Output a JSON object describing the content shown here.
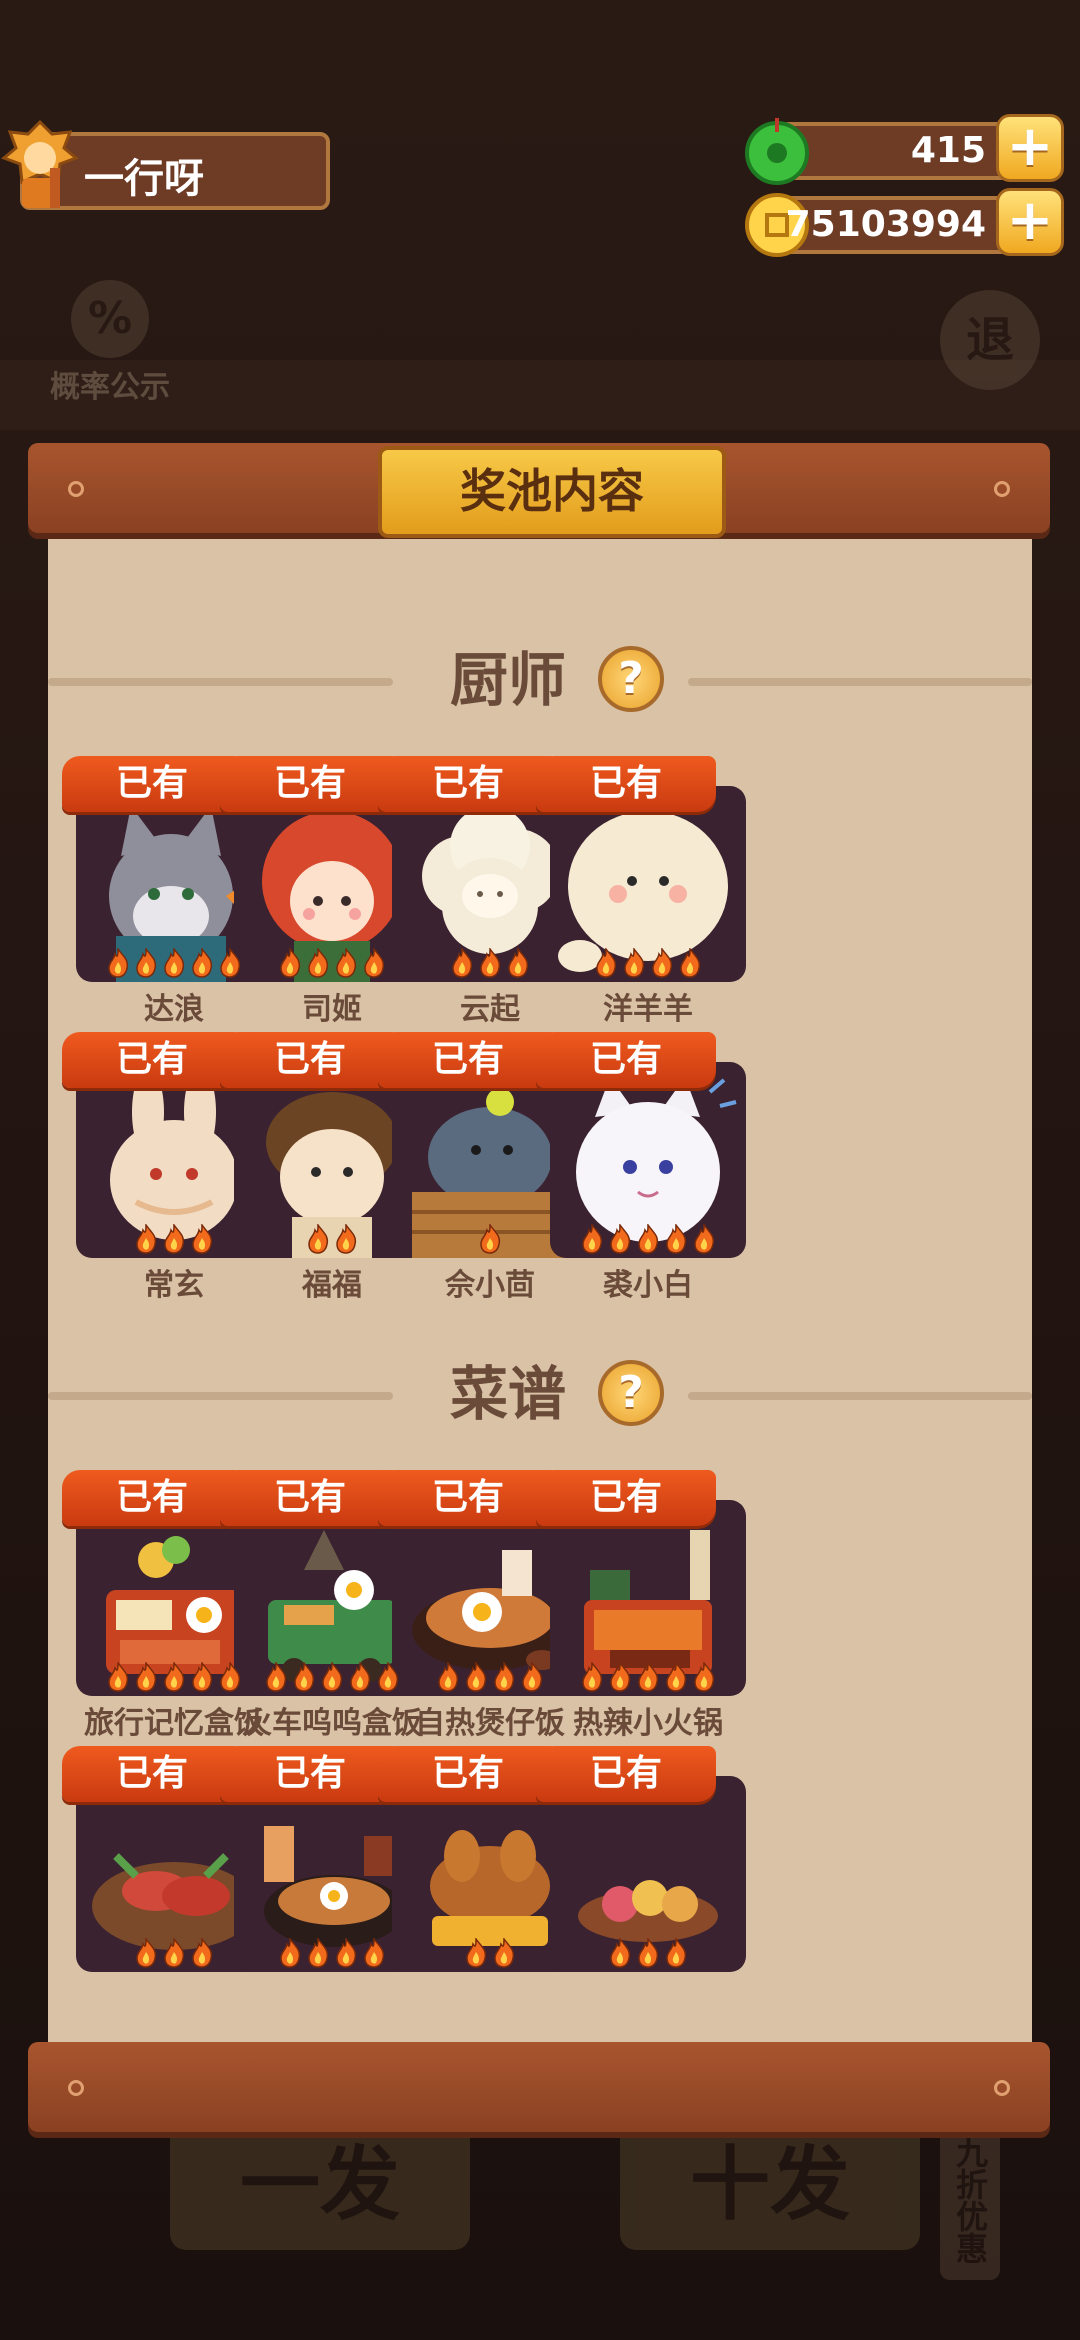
{
  "player": {
    "name": "一行呀"
  },
  "currencies": {
    "jade": "415",
    "coins": "75103994",
    "add_label": "+"
  },
  "background": {
    "probability_label": "概率公示",
    "probability_symbol": "%",
    "exit_label": "退",
    "single_draw_label": "一发",
    "ten_draw_label": "十发",
    "discount_label": "九折优惠"
  },
  "panel": {
    "title": "奖池内容"
  },
  "sections": {
    "chefs": {
      "title": "厨师",
      "help": "?"
    },
    "recipes": {
      "title": "菜谱",
      "help": "?"
    }
  },
  "owned_label": "已有",
  "chefs": [
    {
      "name": "达浪",
      "stars": 5,
      "art": "wolf-chef-art"
    },
    {
      "name": "司姬",
      "stars": 4,
      "art": "red-hair-girl-art"
    },
    {
      "name": "云起",
      "stars": 3,
      "art": "cloud-sheep-art"
    },
    {
      "name": "洋羊羊",
      "stars": 4,
      "art": "white-sheep-art"
    },
    {
      "name": "常玄",
      "stars": 3,
      "art": "rabbit-art"
    },
    {
      "name": "福福",
      "stars": 2,
      "art": "brown-hair-kid-art"
    },
    {
      "name": "佘小茴",
      "stars": 1,
      "art": "seal-in-basket-art"
    },
    {
      "name": "裘小白",
      "stars": 5,
      "art": "white-cat-art"
    }
  ],
  "recipes": [
    {
      "name": "旅行记忆盒饭",
      "stars": 5,
      "art": "bento-box-art"
    },
    {
      "name": "火车呜呜盒饭",
      "stars": 5,
      "art": "train-bento-art"
    },
    {
      "name": "自热煲仔饭",
      "stars": 4,
      "art": "claypot-rice-art"
    },
    {
      "name": "热辣小火锅",
      "stars": 5,
      "art": "hotpot-art"
    },
    {
      "name": "",
      "stars": 3,
      "art": "sausage-platter-art"
    },
    {
      "name": "",
      "stars": 4,
      "art": "noodle-set-art"
    },
    {
      "name": "",
      "stars": 2,
      "art": "roast-chicken-art"
    },
    {
      "name": "",
      "stars": 3,
      "art": "dessert-cups-art"
    }
  ],
  "colors": {
    "badge": "#e04a18",
    "panel_wood": "#9a4a28",
    "parchment": "#d9c2a6",
    "card_bg": "#3b2230",
    "flame": "#f26a1b"
  }
}
